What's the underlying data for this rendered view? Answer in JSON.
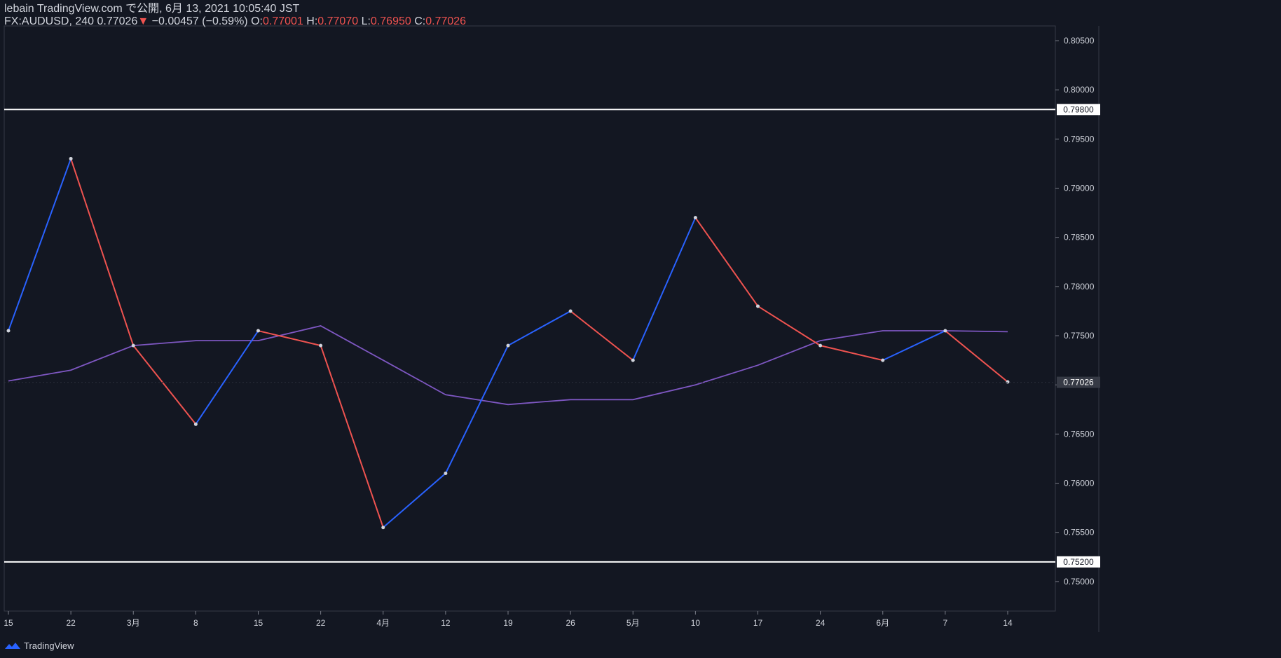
{
  "header": {
    "published": "lebain TradingView.com で公開, 6月 13, 2021 10:05:40 JST",
    "symbol": "FX:AUDUSD, 240",
    "last": "0.77026",
    "arrow": "▼",
    "change": "−0.00457 (−0.59%)",
    "o_label": "O:",
    "o_value": "0.77001",
    "h_label": "H:",
    "h_value": "0.77070",
    "l_label": "L:",
    "l_value": "0.76950",
    "c_label": "C:",
    "c_value": "0.77026"
  },
  "footer": {
    "brand": "TradingView",
    "icon": "tradingview-cloud-icon"
  },
  "colors": {
    "background": "#131722",
    "up": "#2962ff",
    "down": "#ef5350",
    "ma": "#7e57c2",
    "level": "#ffffff",
    "text": "#d1d4dc",
    "axis": "#363a45"
  },
  "chart_data": {
    "type": "line",
    "symbol": "FX:AUDUSD",
    "interval": "240",
    "ylim": [
      0.747,
      0.8065
    ],
    "y_ticks": [
      "0.75000",
      "0.75500",
      "0.76000",
      "0.76500",
      "0.77000",
      "0.77500",
      "0.78000",
      "0.78500",
      "0.79000",
      "0.79500",
      "0.80000",
      "0.80500"
    ],
    "x_ticks": [
      "15",
      "22",
      "3月",
      "8",
      "15",
      "22",
      "4月",
      "12",
      "19",
      "26",
      "5月",
      "10",
      "17",
      "24",
      "6月",
      "7",
      "14"
    ],
    "horizontal_levels": [
      {
        "label": "0.79800",
        "value": 0.798
      },
      {
        "label": "0.75200",
        "value": 0.752
      }
    ],
    "last_price_label": "0.77026",
    "last_price": 0.77026,
    "series": [
      {
        "kind": "price",
        "x": [
          "15",
          "22",
          "3月",
          "8",
          "15",
          "22",
          "4月",
          "12",
          "19",
          "26",
          "5月",
          "10",
          "17",
          "24",
          "6月",
          "7",
          "14"
        ],
        "values": [
          0.7755,
          0.793,
          0.774,
          0.766,
          0.7755,
          0.774,
          0.7555,
          0.761,
          0.774,
          0.7775,
          0.7725,
          0.787,
          0.778,
          0.774,
          0.7725,
          0.7755,
          0.7703
        ]
      },
      {
        "kind": "moving_average",
        "x": [
          "15",
          "22",
          "3月",
          "8",
          "15",
          "22",
          "4月",
          "12",
          "19",
          "26",
          "5月",
          "10",
          "17",
          "24",
          "6月",
          "7",
          "14"
        ],
        "values": [
          0.7704,
          0.7715,
          0.774,
          0.7745,
          0.7745,
          0.776,
          0.7725,
          0.769,
          0.768,
          0.7685,
          0.7685,
          0.77,
          0.772,
          0.7745,
          0.7755,
          0.7755,
          0.7754
        ]
      }
    ]
  }
}
